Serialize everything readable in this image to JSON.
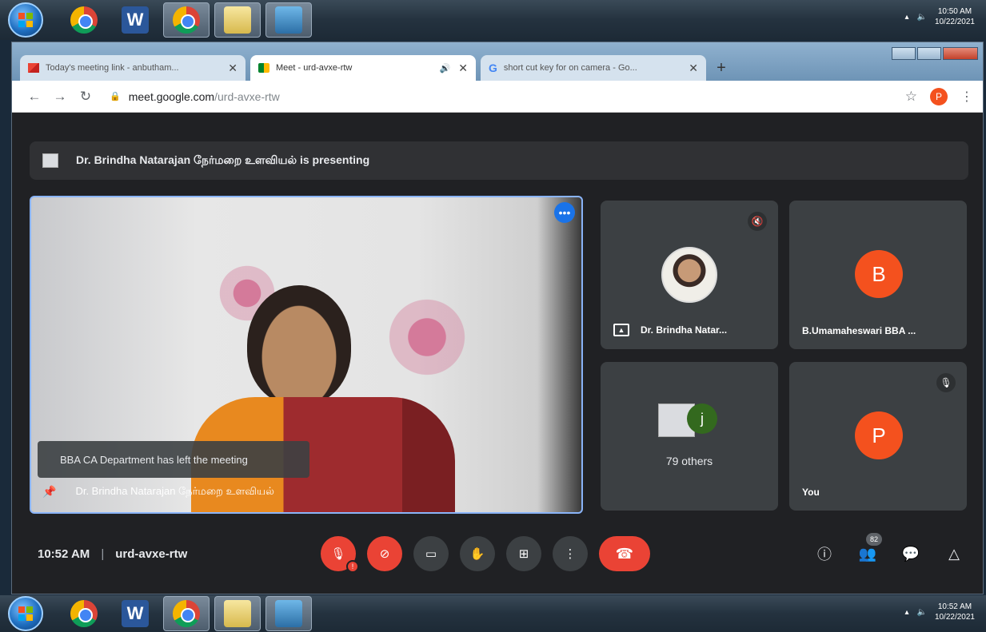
{
  "taskbar": {
    "apps": [
      "chrome-icon",
      "word-icon",
      "chrome-icon",
      "folder-icon",
      "network-icon"
    ],
    "word_letter": "W",
    "clock_top": {
      "time": "10:50 AM",
      "date": "10/22/2021"
    },
    "clock_bottom": {
      "time": "10:52 AM",
      "date": "10/22/2021"
    }
  },
  "browser": {
    "tabs": [
      {
        "title": "Today's meeting link - anbutham...",
        "active": false
      },
      {
        "title": "Meet - urd-avxe-rtw",
        "active": true
      },
      {
        "title": "short cut key for on camera - Go...",
        "active": false
      }
    ],
    "url_domain": "meet.google.com",
    "url_path": "/urd-avxe-rtw",
    "profile_letter": "P"
  },
  "meet": {
    "presenting_text": "Dr. Brindha Natarajan நேர்மறை உளவியல் is presenting",
    "toast": "BBA CA Department has left the meeting",
    "main_participant": "Dr. Brindha Natarajan நேர்மறை உளவியல்",
    "tiles": {
      "presenter_name": "Dr. Brindha Natar...",
      "b_letter": "B",
      "b_name": "B.Umamaheswari BBA ...",
      "others_letter": "j",
      "others_label": "79 others",
      "you_letter": "P",
      "you_label": "You"
    },
    "time": "10:52 AM",
    "code": "urd-avxe-rtw",
    "people_count": "82"
  },
  "colors": {
    "accent": "#1a73e8",
    "danger": "#ea4335",
    "avatar": "#f4511e",
    "bg": "#202124"
  }
}
